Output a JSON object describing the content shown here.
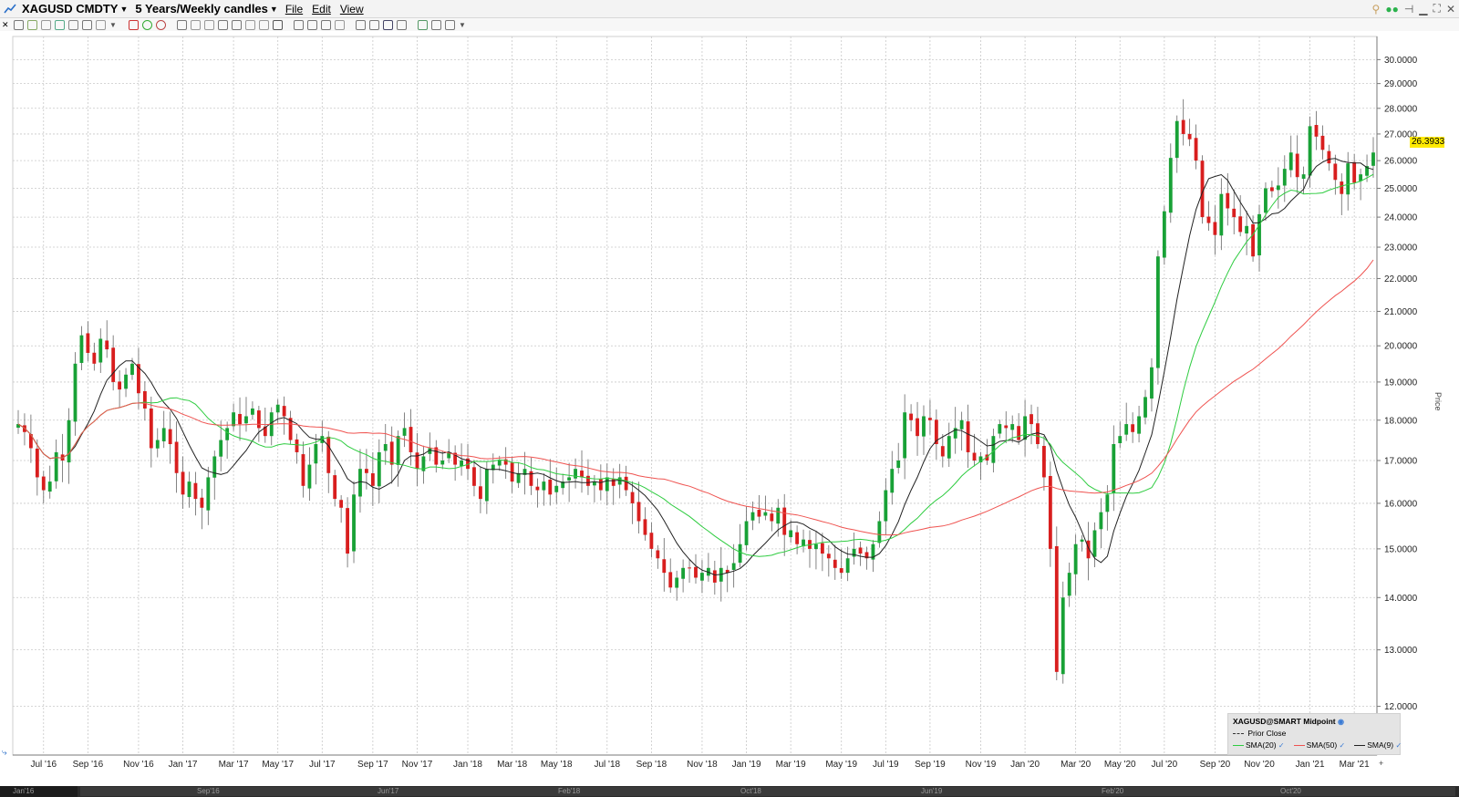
{
  "window": {
    "symbol": "XAGUSD CMDTY",
    "period": "5 Years/Weekly candles",
    "menus": [
      "File",
      "Edit",
      "View"
    ]
  },
  "toolbar": {
    "icons": [
      "close-icon",
      "crosshair-icon",
      "line-icon",
      "grid-icon",
      "magnet-icon",
      "settings-icon",
      "bars-icon",
      "table-icon",
      "dropdown-icon",
      "pencil-icon",
      "circle-icon",
      "bullseye-icon",
      "text-icon",
      "undo-icon",
      "redo-icon",
      "table-icon",
      "table2-icon",
      "undo-icon",
      "redo-icon",
      "draw-line-icon",
      "fib-icon",
      "zoom-in-icon",
      "zoom-out-icon",
      "reset-icon",
      "bar-type-icon",
      "bar-type2-icon",
      "candle-icon",
      "ruler-icon",
      "settings-icon",
      "refresh-icon",
      "link-icon",
      "dropdown-icon"
    ]
  },
  "colors": {
    "up_candle": "#18a136",
    "down_candle": "#d81e1e",
    "sma9": "#222222",
    "sma20": "#2ecc40",
    "sma50": "#ef5350",
    "price_tag": "#ffea00"
  },
  "price_axis": {
    "title": "Price",
    "current_price": "26.3933"
  },
  "legend": {
    "title": "XAGUSD@SMART Midpoint",
    "prior_close": "Prior Close",
    "studies": [
      "SMA(20)",
      "SMA(50)",
      "SMA(9)"
    ]
  },
  "scrollbar": {
    "labels": [
      "Jan'16",
      "Sep'16",
      "Jun'17",
      "Feb'18",
      "Oct'18",
      "Jun'19",
      "Feb'20",
      "Oct'20"
    ]
  },
  "chart_data": {
    "type": "candlestick",
    "interval": "weekly",
    "y_scale": "log",
    "ylim": [
      11.2,
      31.0
    ],
    "grid": true,
    "y_ticks": [
      "12.0000",
      "13.0000",
      "14.0000",
      "15.0000",
      "16.0000",
      "17.0000",
      "18.0000",
      "19.0000",
      "20.0000",
      "21.0000",
      "22.0000",
      "23.0000",
      "24.0000",
      "25.0000",
      "26.0000",
      "27.0000",
      "28.0000",
      "29.0000",
      "30.0000"
    ],
    "x_ticks": [
      "Jul '16",
      "Sep '16",
      "Nov '16",
      "Jan '17",
      "Mar '17",
      "May '17",
      "Jul '17",
      "Sep '17",
      "Nov '17",
      "Jan '18",
      "Mar '18",
      "May '18",
      "Jul '18",
      "Sep '18",
      "Nov '18",
      "Jan '19",
      "Mar '19",
      "May '19",
      "Jul '19",
      "Sep '19",
      "Nov '19",
      "Jan '20",
      "Mar '20",
      "May '20",
      "Jul '20",
      "Sep '20",
      "Nov '20",
      "Jan '21",
      "Mar '21"
    ],
    "series": [
      {
        "name": "XAGUSD",
        "close": [
          17.9,
          17.7,
          17.3,
          16.6,
          16.3,
          16.5,
          17.2,
          17.0,
          18.0,
          19.5,
          20.3,
          19.8,
          19.5,
          20.2,
          19.9,
          19.0,
          18.8,
          19.2,
          19.5,
          18.7,
          18.3,
          17.3,
          17.5,
          17.8,
          17.4,
          16.7,
          16.2,
          16.5,
          16.1,
          15.9,
          16.6,
          17.1,
          17.5,
          17.8,
          18.2,
          17.9,
          18.1,
          18.3,
          17.8,
          17.6,
          18.2,
          18.4,
          18.1,
          17.5,
          17.2,
          16.4,
          16.9,
          17.4,
          17.6,
          16.7,
          16.1,
          15.9,
          14.9,
          16.2,
          16.8,
          16.7,
          16.4,
          17.2,
          17.4,
          16.9,
          17.6,
          17.8,
          17.2,
          16.8,
          17.1,
          17.3,
          16.9,
          17.0,
          17.2,
          16.9,
          17.0,
          16.8,
          16.4,
          16.1,
          16.8,
          16.9,
          17.0,
          16.9,
          16.5,
          16.7,
          16.8,
          16.4,
          16.3,
          16.5,
          16.2,
          16.4,
          16.5,
          16.6,
          16.8,
          16.6,
          16.4,
          16.5,
          16.3,
          16.6,
          16.4,
          16.6,
          16.3,
          16.0,
          15.6,
          15.3,
          15.0,
          14.8,
          14.5,
          14.2,
          14.4,
          14.6,
          14.6,
          14.4,
          14.5,
          14.6,
          14.3,
          14.6,
          14.5,
          14.7,
          15.1,
          15.6,
          15.8,
          15.7,
          15.8,
          15.6,
          15.9,
          15.3,
          15.4,
          15.1,
          15.2,
          15.0,
          15.1,
          14.9,
          14.8,
          14.6,
          14.5,
          14.8,
          15.0,
          14.9,
          14.8,
          15.1,
          15.6,
          16.3,
          16.8,
          17.0,
          18.2,
          18.0,
          17.6,
          18.1,
          18.0,
          17.4,
          17.1,
          17.6,
          17.8,
          18.0,
          17.2,
          17.0,
          17.1,
          17.0,
          17.6,
          17.9,
          17.8,
          17.9,
          17.5,
          18.1,
          17.9,
          17.4,
          16.6,
          15.0,
          12.6,
          14.0,
          14.5,
          15.1,
          15.2,
          14.8,
          15.4,
          15.8,
          16.2,
          17.4,
          17.6,
          17.9,
          17.7,
          18.1,
          18.6,
          19.4,
          22.7,
          24.2,
          26.1,
          27.5,
          27.0,
          26.8,
          26.0,
          24.0,
          23.8,
          23.4,
          24.8,
          24.3,
          24.0,
          23.5,
          23.7,
          22.7,
          24.1,
          25.0,
          24.9,
          25.1,
          25.7,
          26.3,
          25.4,
          25.5,
          27.3,
          26.9,
          26.4,
          25.9,
          25.3,
          24.8,
          25.9,
          25.2,
          25.5,
          25.8,
          26.3
        ]
      }
    ],
    "overlays": [
      {
        "name": "SMA(9)"
      },
      {
        "name": "SMA(20)"
      },
      {
        "name": "SMA(50)"
      }
    ]
  }
}
